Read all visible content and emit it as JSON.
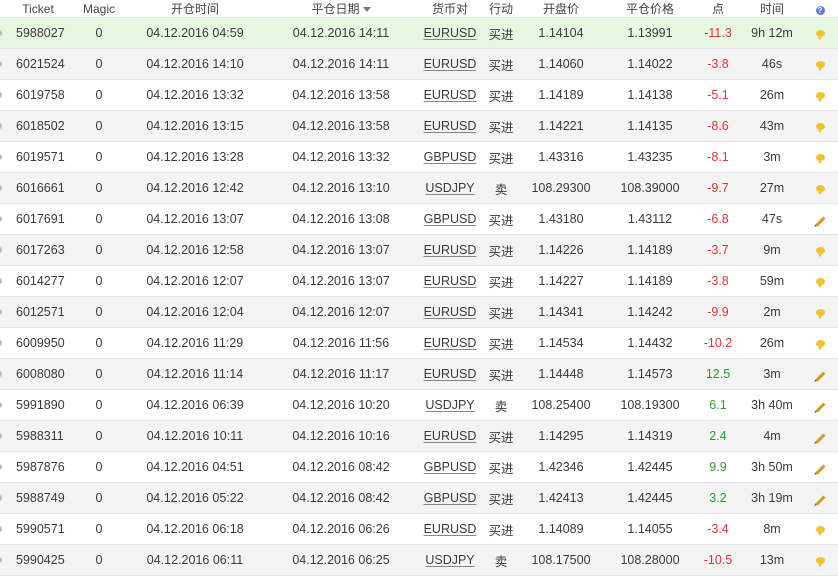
{
  "headers": {
    "ticket": "Ticket",
    "magic": "Magic",
    "open_time": "开仓时间",
    "close_date": "平仓日期",
    "symbol": "货币对",
    "action": "行动",
    "open_price": "开盘价",
    "close_price": "平仓价格",
    "points": "点",
    "duration": "时间",
    "help_glyph": "?"
  },
  "rows": [
    {
      "ticket": "5988027",
      "magic": "0",
      "open_time": "04.12.2016 04:59",
      "close_time": "04.12.2016 14:11",
      "symbol": "EURUSD",
      "action": "买进",
      "open_price": "1.14104",
      "close_price": "1.13991",
      "points": "-11.3",
      "duration": "9h 12m",
      "icon": "comment-icon",
      "highlight": true
    },
    {
      "ticket": "6021524",
      "magic": "0",
      "open_time": "04.12.2016 14:10",
      "close_time": "04.12.2016 14:11",
      "symbol": "EURUSD",
      "action": "买进",
      "open_price": "1.14060",
      "close_price": "1.14022",
      "points": "-3.8",
      "duration": "46s",
      "icon": "comment-icon"
    },
    {
      "ticket": "6019758",
      "magic": "0",
      "open_time": "04.12.2016 13:32",
      "close_time": "04.12.2016 13:58",
      "symbol": "EURUSD",
      "action": "买进",
      "open_price": "1.14189",
      "close_price": "1.14138",
      "points": "-5.1",
      "duration": "26m",
      "icon": "comment-icon"
    },
    {
      "ticket": "6018502",
      "magic": "0",
      "open_time": "04.12.2016 13:15",
      "close_time": "04.12.2016 13:58",
      "symbol": "EURUSD",
      "action": "买进",
      "open_price": "1.14221",
      "close_price": "1.14135",
      "points": "-8.6",
      "duration": "43m",
      "icon": "comment-icon"
    },
    {
      "ticket": "6019571",
      "magic": "0",
      "open_time": "04.12.2016 13:28",
      "close_time": "04.12.2016 13:32",
      "symbol": "GBPUSD",
      "action": "买进",
      "open_price": "1.43316",
      "close_price": "1.43235",
      "points": "-8.1",
      "duration": "3m",
      "icon": "comment-icon"
    },
    {
      "ticket": "6016661",
      "magic": "0",
      "open_time": "04.12.2016 12:42",
      "close_time": "04.12.2016 13:10",
      "symbol": "USDJPY",
      "action": "卖",
      "open_price": "108.29300",
      "close_price": "108.39000",
      "points": "-9.7",
      "duration": "27m",
      "icon": "comment-icon"
    },
    {
      "ticket": "6017691",
      "magic": "0",
      "open_time": "04.12.2016 13:07",
      "close_time": "04.12.2016 13:08",
      "symbol": "GBPUSD",
      "action": "买进",
      "open_price": "1.43180",
      "close_price": "1.43112",
      "points": "-6.8",
      "duration": "47s",
      "icon": "edit-icon"
    },
    {
      "ticket": "6017263",
      "magic": "0",
      "open_time": "04.12.2016 12:58",
      "close_time": "04.12.2016 13:07",
      "symbol": "EURUSD",
      "action": "买进",
      "open_price": "1.14226",
      "close_price": "1.14189",
      "points": "-3.7",
      "duration": "9m",
      "icon": "comment-icon"
    },
    {
      "ticket": "6014277",
      "magic": "0",
      "open_time": "04.12.2016 12:07",
      "close_time": "04.12.2016 13:07",
      "symbol": "EURUSD",
      "action": "买进",
      "open_price": "1.14227",
      "close_price": "1.14189",
      "points": "-3.8",
      "duration": "59m",
      "icon": "comment-icon"
    },
    {
      "ticket": "6012571",
      "magic": "0",
      "open_time": "04.12.2016 12:04",
      "close_time": "04.12.2016 12:07",
      "symbol": "EURUSD",
      "action": "买进",
      "open_price": "1.14341",
      "close_price": "1.14242",
      "points": "-9.9",
      "duration": "2m",
      "icon": "comment-icon"
    },
    {
      "ticket": "6009950",
      "magic": "0",
      "open_time": "04.12.2016 11:29",
      "close_time": "04.12.2016 11:56",
      "symbol": "EURUSD",
      "action": "买进",
      "open_price": "1.14534",
      "close_price": "1.14432",
      "points": "-10.2",
      "duration": "26m",
      "icon": "comment-icon"
    },
    {
      "ticket": "6008080",
      "magic": "0",
      "open_time": "04.12.2016 11:14",
      "close_time": "04.12.2016 11:17",
      "symbol": "EURUSD",
      "action": "买进",
      "open_price": "1.14448",
      "close_price": "1.14573",
      "points": "12.5",
      "duration": "3m",
      "icon": "edit-icon"
    },
    {
      "ticket": "5991890",
      "magic": "0",
      "open_time": "04.12.2016 06:39",
      "close_time": "04.12.2016 10:20",
      "symbol": "USDJPY",
      "action": "卖",
      "open_price": "108.25400",
      "close_price": "108.19300",
      "points": "6.1",
      "duration": "3h 40m",
      "icon": "edit-icon"
    },
    {
      "ticket": "5988311",
      "magic": "0",
      "open_time": "04.12.2016 10:11",
      "close_time": "04.12.2016 10:16",
      "symbol": "EURUSD",
      "action": "买进",
      "open_price": "1.14295",
      "close_price": "1.14319",
      "points": "2.4",
      "duration": "4m",
      "icon": "edit-icon"
    },
    {
      "ticket": "5987876",
      "magic": "0",
      "open_time": "04.12.2016 04:51",
      "close_time": "04.12.2016 08:42",
      "symbol": "GBPUSD",
      "action": "买进",
      "open_price": "1.42346",
      "close_price": "1.42445",
      "points": "9.9",
      "duration": "3h 50m",
      "icon": "edit-icon"
    },
    {
      "ticket": "5988749",
      "magic": "0",
      "open_time": "04.12.2016 05:22",
      "close_time": "04.12.2016 08:42",
      "symbol": "GBPUSD",
      "action": "买进",
      "open_price": "1.42413",
      "close_price": "1.42445",
      "points": "3.2",
      "duration": "3h 19m",
      "icon": "edit-icon"
    },
    {
      "ticket": "5990571",
      "magic": "0",
      "open_time": "04.12.2016 06:18",
      "close_time": "04.12.2016 06:26",
      "symbol": "EURUSD",
      "action": "买进",
      "open_price": "1.14089",
      "close_price": "1.14055",
      "points": "-3.4",
      "duration": "8m",
      "icon": "comment-icon"
    },
    {
      "ticket": "5990425",
      "magic": "0",
      "open_time": "04.12.2016 06:11",
      "close_time": "04.12.2016 06:25",
      "symbol": "USDJPY",
      "action": "卖",
      "open_price": "108.17500",
      "close_price": "108.28000",
      "points": "-10.5",
      "duration": "13m",
      "icon": "comment-icon"
    }
  ]
}
